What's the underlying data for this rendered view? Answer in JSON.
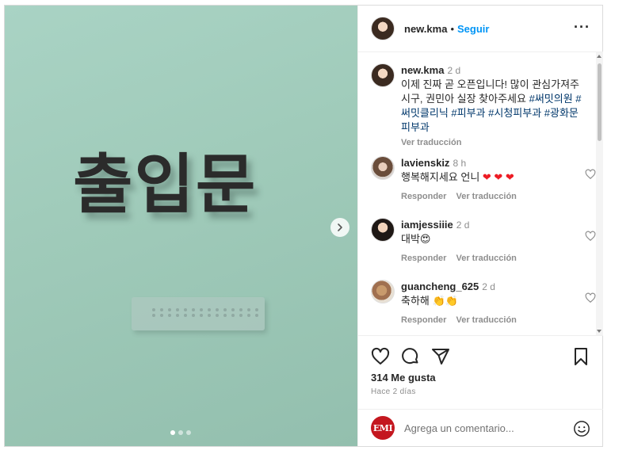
{
  "media": {
    "sign_text": "출입문",
    "carousel_dots": 3,
    "active_dot": 1
  },
  "header": {
    "username": "new.kma",
    "separator": "•",
    "follow_label": "Seguir",
    "more_icon": "more-horizontal-icon"
  },
  "caption": {
    "username": "new.kma",
    "time": "2 d",
    "text_plain": "이제 진짜 곧 오픈입니다! 많이 관심가져주시구, 권민아 실장 찾아주세요 ",
    "hashtags": "#써밋의원 #써밋클리닉 #피부과 #시청피부과 #광화문피부과",
    "translate": "Ver traducción"
  },
  "comments": [
    {
      "username": "lavienskiz",
      "time": "8 h",
      "text": "행복해지세요 언니",
      "emoji": "❤ ❤ ❤",
      "reply": "Responder",
      "translate": "Ver traducción"
    },
    {
      "username": "iamjessiiie",
      "time": "2 d",
      "text": "대박",
      "emoji": "😍",
      "reply": "Responder",
      "translate": "Ver traducción"
    },
    {
      "username": "guancheng_625",
      "time": "2 d",
      "text": "축하해",
      "emoji": "👏👏",
      "reply": "Responder",
      "translate": "Ver traducción"
    }
  ],
  "actions": {
    "likes": "314 Me gusta",
    "ago": "Hace 2 días"
  },
  "add_comment": {
    "avatar_text": "EMI",
    "placeholder": "Agrega un comentario..."
  },
  "colors": {
    "accent": "#0095f6",
    "hashtag": "#00376b",
    "muted": "#8e8e8e",
    "heart_red": "#ed1c24",
    "image_bg": "#a9d3c4"
  }
}
